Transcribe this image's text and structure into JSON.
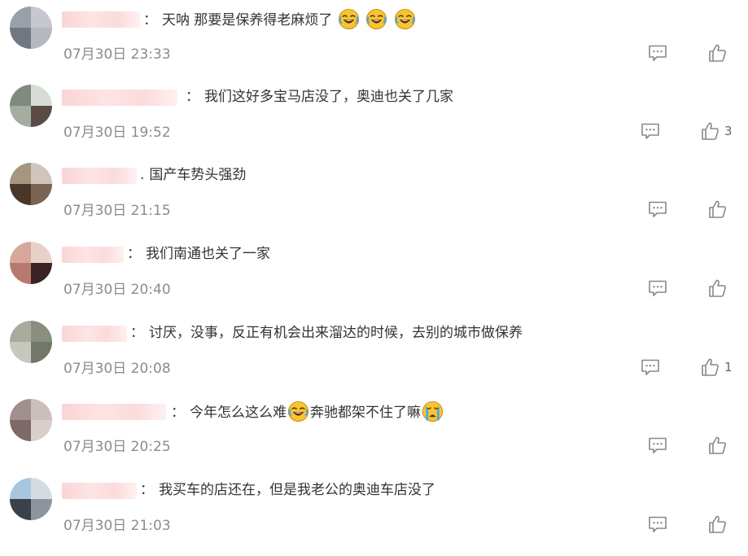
{
  "comments": [
    {
      "separator": "：",
      "text_parts": [
        "天呐 那要是保养得老麻烦了"
      ],
      "emojis": [
        "crying-laughing",
        "crying-laughing",
        "crying-laughing"
      ],
      "timestamp": "07月30日 23:33",
      "likes": ""
    },
    {
      "separator": "：",
      "text": "我们这好多宝马店没了，奥迪也关了几家",
      "timestamp": "07月30日 19:52",
      "likes": "3"
    },
    {
      "separator": ".",
      "text": "国产车势头强劲",
      "timestamp": "07月30日 21:15",
      "likes": ""
    },
    {
      "separator": "：",
      "text": "我们南通也关了一家",
      "timestamp": "07月30日 20:40",
      "likes": ""
    },
    {
      "separator": "：",
      "text": "讨厌，没事，反正有机会出来溜达的时候，去别的城市做保养",
      "timestamp": "07月30日 20:08",
      "likes": "1"
    },
    {
      "separator": "：",
      "text_a": "今年怎么这么难",
      "text_b": "奔驰都架不住了嘛",
      "timestamp": "07月30日 20:25",
      "likes": ""
    },
    {
      "separator": "：",
      "text": "我买车的店还在，但是我老公的奥迪车店没了",
      "timestamp": "07月30日 21:03",
      "likes": ""
    }
  ],
  "icons": {
    "reply": "comment-bubble-icon",
    "like": "thumbs-up-icon"
  },
  "colors": {
    "text": "#333333",
    "timestamp": "#8c8c8c",
    "icon": "#888888",
    "username_blur": "#f9d4d4"
  }
}
